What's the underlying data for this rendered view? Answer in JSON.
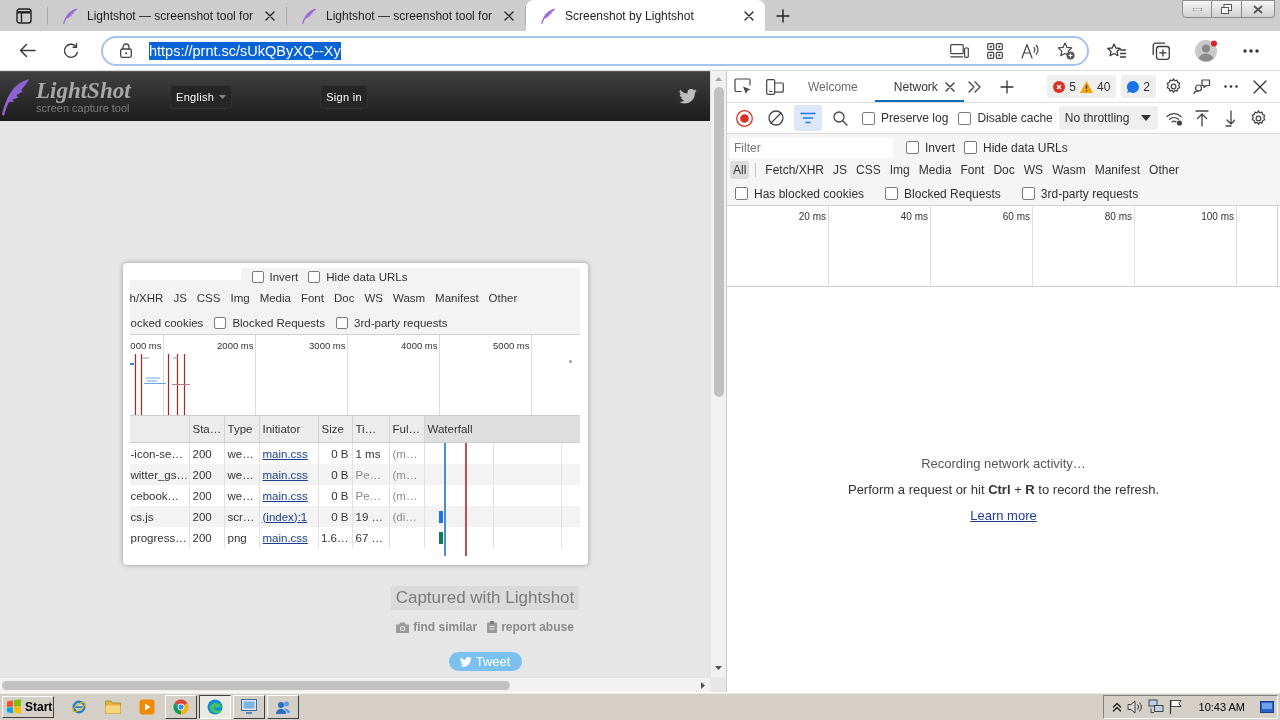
{
  "browser": {
    "tabs": [
      {
        "title": "Lightshot — screenshot tool for",
        "selected": false
      },
      {
        "title": "Lightshot — screenshot tool for",
        "selected": false
      },
      {
        "title": "Screenshot by Lightshot",
        "selected": true
      }
    ],
    "address_bar": {
      "url": "https://prnt.sc/sUkQByXQ--Xy",
      "url_selected": true
    }
  },
  "page": {
    "header": {
      "logo_title": "LightShot",
      "logo_subtitle": "screen capture tool",
      "language": "English",
      "sign_in": "Sign in"
    },
    "screenshot": {
      "filter_options": [
        {
          "label": "Invert",
          "checked": false
        },
        {
          "label": "Hide data URLs",
          "checked": false
        }
      ],
      "types": [
        "h/XHR",
        "JS",
        "CSS",
        "Img",
        "Media",
        "Font",
        "Doc",
        "WS",
        "Wasm",
        "Manifest",
        "Other"
      ],
      "cut_option": "ocked cookies",
      "options": [
        {
          "label": "Blocked Requests",
          "checked": false
        },
        {
          "label": "3rd-party requests",
          "checked": false
        }
      ],
      "overview_ticks": [
        "000 ms",
        "2000 ms",
        "3000 ms",
        "4000 ms",
        "5000 ms"
      ],
      "columns": [
        "Sta…",
        "Type",
        "Initiator",
        "Size",
        "Ti…",
        "Ful…",
        "Waterfall"
      ],
      "rows": [
        {
          "name": "-icon-se…",
          "status": "200",
          "type": "we…",
          "initiator": "main.css",
          "size": "0 B",
          "time": "1 ms",
          "pending": false,
          "fulfilled": "(m…"
        },
        {
          "name": "witter_gs…",
          "status": "200",
          "type": "we…",
          "initiator": "main.css",
          "size": "0 B",
          "time": "Pe…",
          "pending": true,
          "fulfilled": "(m…"
        },
        {
          "name": "cebook…",
          "status": "200",
          "type": "we…",
          "initiator": "main.css",
          "size": "0 B",
          "time": "Pe…",
          "pending": true,
          "fulfilled": "(m…"
        },
        {
          "name": "cs.js",
          "status": "200",
          "type": "scr…",
          "initiator": "(index):1",
          "size": "0 B",
          "time": "19 …",
          "pending": false,
          "fulfilled": "(di…",
          "color": "#1a73e8"
        },
        {
          "name": "progress…",
          "status": "200",
          "type": "png",
          "initiator": "main.css",
          "size": "1.6…",
          "time": "67 …",
          "pending": false,
          "color": "#137a5a"
        }
      ]
    },
    "caption": "Captured with Lightshot",
    "links": [
      {
        "kind": "camera",
        "label": "find similar"
      },
      {
        "kind": "clipboard",
        "label": "report abuse"
      }
    ],
    "tweet": "Tweet"
  },
  "devtools": {
    "tabs": [
      {
        "label": "Welcome",
        "selected": false
      },
      {
        "label": "Network",
        "selected": true
      }
    ],
    "counters": [
      {
        "kind": "error",
        "count": "5"
      },
      {
        "kind": "warning",
        "count": "40"
      },
      {
        "kind": "info",
        "count": "2"
      }
    ],
    "recording": true,
    "filter_active": true,
    "checkboxes": [
      {
        "label": "Preserve log",
        "checked": false
      },
      {
        "label": "Disable cache",
        "checked": false
      }
    ],
    "throttling": "No throttling",
    "filter": {
      "placeholder": "Filter"
    },
    "filter_options": [
      {
        "label": "Invert",
        "checked": false
      },
      {
        "label": "Hide data URLs",
        "checked": false
      }
    ],
    "types": [
      {
        "label": "All",
        "selected": true
      },
      {
        "label": "Fetch/XHR",
        "selected": false
      },
      {
        "label": "JS",
        "selected": false
      },
      {
        "label": "CSS",
        "selected": false
      },
      {
        "label": "Img",
        "selected": false
      },
      {
        "label": "Media",
        "selected": false
      },
      {
        "label": "Font",
        "selected": false
      },
      {
        "label": "Doc",
        "selected": false
      },
      {
        "label": "WS",
        "selected": false
      },
      {
        "label": "Wasm",
        "selected": false
      },
      {
        "label": "Manifest",
        "selected": false
      },
      {
        "label": "Other",
        "selected": false
      }
    ],
    "options": [
      {
        "label": "Has blocked cookies",
        "checked": false
      },
      {
        "label": "Blocked Requests",
        "checked": false
      },
      {
        "label": "3rd-party requests",
        "checked": false
      }
    ],
    "overview_ticks": [
      "20 ms",
      "40 ms",
      "60 ms",
      "80 ms",
      "100 ms"
    ],
    "empty_state": {
      "title": "Recording network activity…",
      "message": "Perform a request or hit **Ctrl** + **R** to record the refresh.",
      "link": "Learn more"
    }
  },
  "taskbar": {
    "start": "Start",
    "quick_launch": [
      {
        "kind": "ie"
      },
      {
        "kind": "folder"
      },
      {
        "kind": "media"
      }
    ],
    "tasks": [
      {
        "kind": "chrome",
        "selected": false
      },
      {
        "kind": "edge",
        "selected": true
      },
      {
        "kind": "window",
        "selected": false
      },
      {
        "kind": "network",
        "selected": false
      }
    ],
    "clock": "10:43 AM"
  }
}
